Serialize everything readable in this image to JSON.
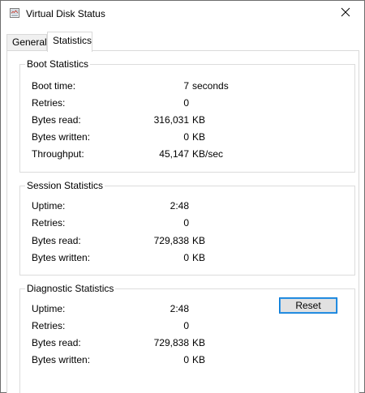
{
  "window": {
    "title": "Virtual Disk Status",
    "icon": "virtual-disk-icon",
    "close_icon": "close-icon"
  },
  "tabs": [
    {
      "label": "General",
      "selected": false
    },
    {
      "label": "Statistics",
      "selected": true
    }
  ],
  "boot": {
    "title": "Boot Statistics",
    "rows": [
      {
        "label": "Boot time:",
        "value": "7",
        "unit": "seconds"
      },
      {
        "label": "Retries:",
        "value": "0",
        "unit": ""
      },
      {
        "label": "Bytes read:",
        "value": "316,031",
        "unit": "KB"
      },
      {
        "label": "Bytes written:",
        "value": "0",
        "unit": "KB"
      },
      {
        "label": "Throughput:",
        "value": "45,147",
        "unit": "KB/sec"
      }
    ]
  },
  "session": {
    "title": "Session Statistics",
    "rows": [
      {
        "label": "Uptime:",
        "value": "2:48",
        "unit": ""
      },
      {
        "label": "Retries:",
        "value": "0",
        "unit": ""
      },
      {
        "label": "Bytes read:",
        "value": "729,838",
        "unit": "KB"
      },
      {
        "label": "Bytes written:",
        "value": "0",
        "unit": "KB"
      }
    ]
  },
  "diagnostic": {
    "title": "Diagnostic Statistics",
    "reset_label": "Reset",
    "rows": [
      {
        "label": "Uptime:",
        "value": "2:48",
        "unit": ""
      },
      {
        "label": "Retries:",
        "value": "0",
        "unit": ""
      },
      {
        "label": "Bytes read:",
        "value": "729,838",
        "unit": "KB"
      },
      {
        "label": "Bytes written:",
        "value": "0",
        "unit": "KB"
      }
    ]
  },
  "colors": {
    "accent": "#0078d7",
    "button_face": "#e1e1e1",
    "group_border": "#dcdcdc"
  }
}
